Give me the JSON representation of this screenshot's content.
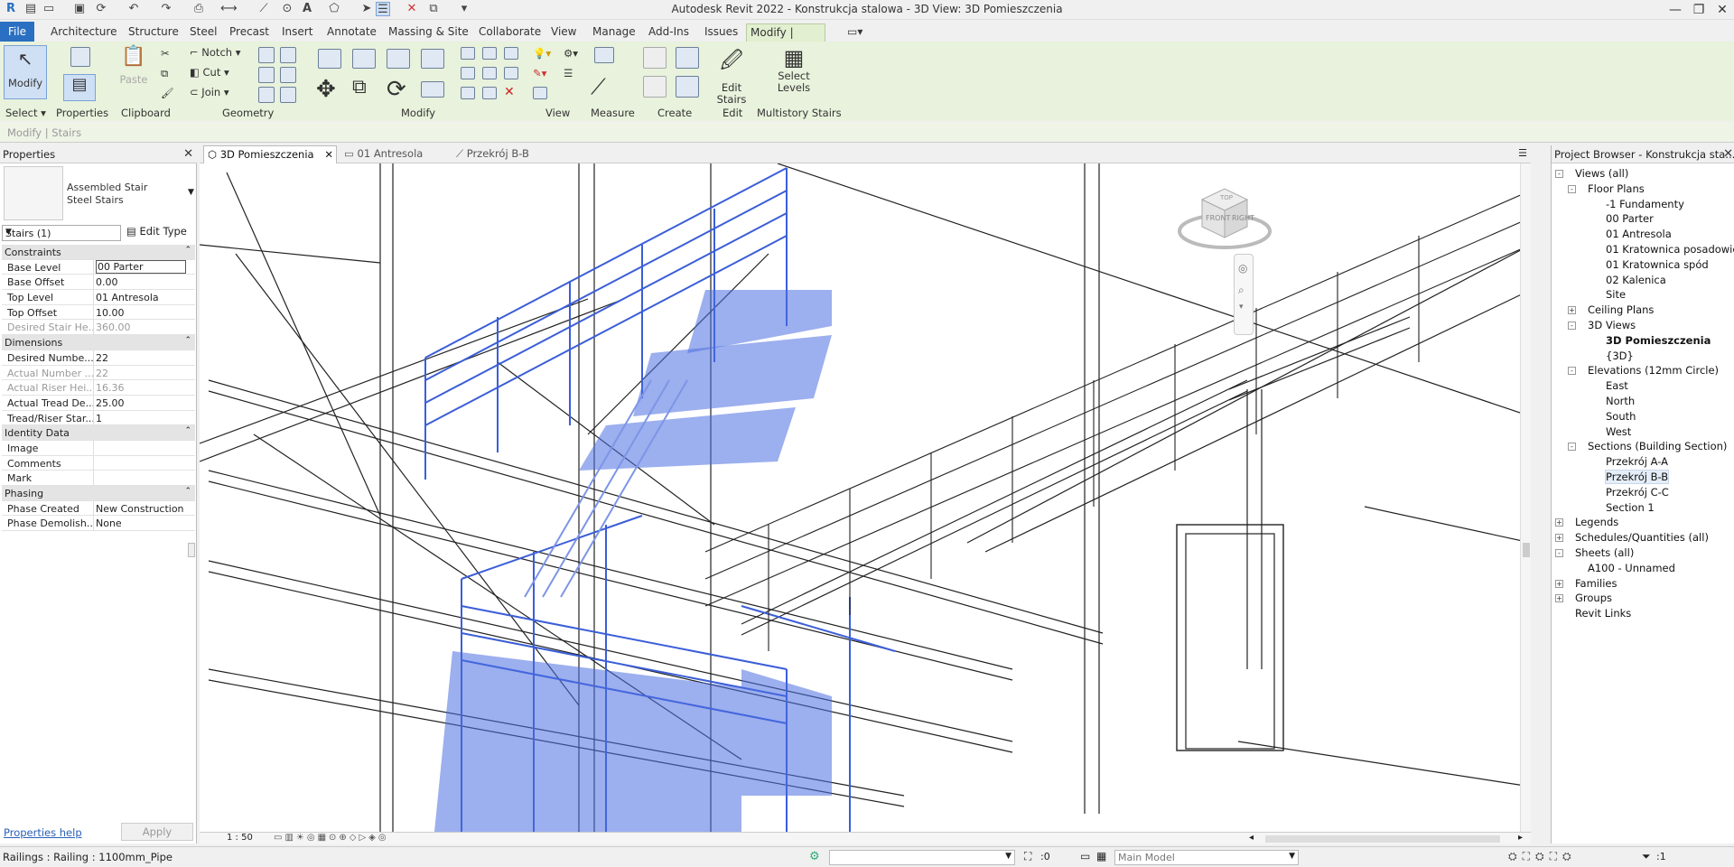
{
  "window": {
    "title": "Autodesk Revit 2022 - Konstrukcja stalowa - 3D View: 3D Pomieszczenia"
  },
  "ribbon_tabs": [
    "File",
    "Architecture",
    "Structure",
    "Steel",
    "Precast",
    "Insert",
    "Annotate",
    "Massing & Site",
    "Collaborate",
    "View",
    "Manage",
    "Add-Ins",
    "Issues",
    "Modify | Stairs"
  ],
  "ribbon": {
    "modify_label": "Modify",
    "paste_label": "Paste",
    "notch_label": "Notch",
    "cut_label": "Cut",
    "join_label": "Join",
    "edit_stairs_label": "Edit Stairs",
    "select_levels_label": "Select Levels",
    "panels": {
      "select": "Select",
      "properties": "Properties",
      "clipboard": "Clipboard",
      "geometry": "Geometry",
      "modify": "Modify",
      "view": "View",
      "measure": "Measure",
      "create": "Create",
      "edit": "Edit",
      "multistory": "Multistory Stairs"
    }
  },
  "options_bar": {
    "context": "Modify | Stairs"
  },
  "properties": {
    "title": "Properties",
    "family": "Assembled Stair",
    "type": "Steel Stairs",
    "selector": "Stairs (1)",
    "edit_type": "Edit Type",
    "sections": [
      {
        "name": "Constraints",
        "rows": [
          {
            "k": "Base Level",
            "v": "00 Parter",
            "gray": false
          },
          {
            "k": "Base Offset",
            "v": "0.00",
            "gray": false
          },
          {
            "k": "Top Level",
            "v": "01 Antresola",
            "gray": false
          },
          {
            "k": "Top Offset",
            "v": "10.00",
            "gray": false
          },
          {
            "k": "Desired Stair He...",
            "v": "360.00",
            "gray": true
          }
        ]
      },
      {
        "name": "Dimensions",
        "rows": [
          {
            "k": "Desired Numbe...",
            "v": "22",
            "gray": false
          },
          {
            "k": "Actual Number ...",
            "v": "22",
            "gray": true
          },
          {
            "k": "Actual Riser Hei...",
            "v": "16.36",
            "gray": true
          },
          {
            "k": "Actual Tread De...",
            "v": "25.00",
            "gray": false
          },
          {
            "k": "Tread/Riser Star...",
            "v": "1",
            "gray": false
          }
        ]
      },
      {
        "name": "Identity Data",
        "rows": [
          {
            "k": "Image",
            "v": "",
            "gray": false
          },
          {
            "k": "Comments",
            "v": "",
            "gray": false
          },
          {
            "k": "Mark",
            "v": "",
            "gray": false
          }
        ]
      },
      {
        "name": "Phasing",
        "rows": [
          {
            "k": "Phase Created",
            "v": "New Construction",
            "gray": false
          },
          {
            "k": "Phase Demolish...",
            "v": "None",
            "gray": false
          }
        ]
      }
    ],
    "help": "Properties help",
    "apply": "Apply"
  },
  "view_tabs": [
    "3D Pomieszczenia",
    "01 Antresola",
    "Przekrój B-B"
  ],
  "view_control": {
    "scale": "1 : 50"
  },
  "project_browser": {
    "title": "Project Browser - Konstrukcja sta...",
    "items": [
      {
        "label": "Views (all)",
        "level": 0,
        "exp": "-"
      },
      {
        "label": "Floor Plans",
        "level": 1,
        "exp": "-"
      },
      {
        "label": "-1 Fundamenty",
        "level": 2
      },
      {
        "label": "00 Parter",
        "level": 2
      },
      {
        "label": "01 Antresola",
        "level": 2
      },
      {
        "label": "01 Kratownica posadowie",
        "level": 2
      },
      {
        "label": "01 Kratownica spód",
        "level": 2
      },
      {
        "label": "02 Kalenica",
        "level": 2
      },
      {
        "label": "Site",
        "level": 2
      },
      {
        "label": "Ceiling Plans",
        "level": 1,
        "exp": "+"
      },
      {
        "label": "3D Views",
        "level": 1,
        "exp": "-"
      },
      {
        "label": "3D Pomieszczenia",
        "level": 2,
        "bold": true
      },
      {
        "label": "{3D}",
        "level": 2
      },
      {
        "label": "Elevations (12mm Circle)",
        "level": 1,
        "exp": "-"
      },
      {
        "label": "East",
        "level": 2
      },
      {
        "label": "North",
        "level": 2
      },
      {
        "label": "South",
        "level": 2
      },
      {
        "label": "West",
        "level": 2
      },
      {
        "label": "Sections (Building Section)",
        "level": 1,
        "exp": "-"
      },
      {
        "label": "Przekrój A-A",
        "level": 2
      },
      {
        "label": "Przekrój B-B",
        "level": 2,
        "sel": true
      },
      {
        "label": "Przekrój C-C",
        "level": 2
      },
      {
        "label": "Section 1",
        "level": 2
      },
      {
        "label": "Legends",
        "level": 0,
        "exp": "+"
      },
      {
        "label": "Schedules/Quantities (all)",
        "level": 0,
        "exp": "+"
      },
      {
        "label": "Sheets (all)",
        "level": 0,
        "exp": "-"
      },
      {
        "label": "A100 - Unnamed",
        "level": 1
      },
      {
        "label": "Families",
        "level": 0,
        "exp": "+"
      },
      {
        "label": "Groups",
        "level": 0,
        "exp": "+"
      },
      {
        "label": "Revit Links",
        "level": 0
      }
    ]
  },
  "status": {
    "text": "Railings : Railing : 1100mm_Pipe",
    "count": ":0",
    "model": "Main Model",
    "filter": ":1"
  },
  "viewcube": {
    "front": "FRONT",
    "right": "RIGHT",
    "top": "TOP"
  },
  "colors": {
    "accent": "#2a6fc1",
    "selection": "#3b5ed8",
    "context_tab": "#e2efd0"
  }
}
